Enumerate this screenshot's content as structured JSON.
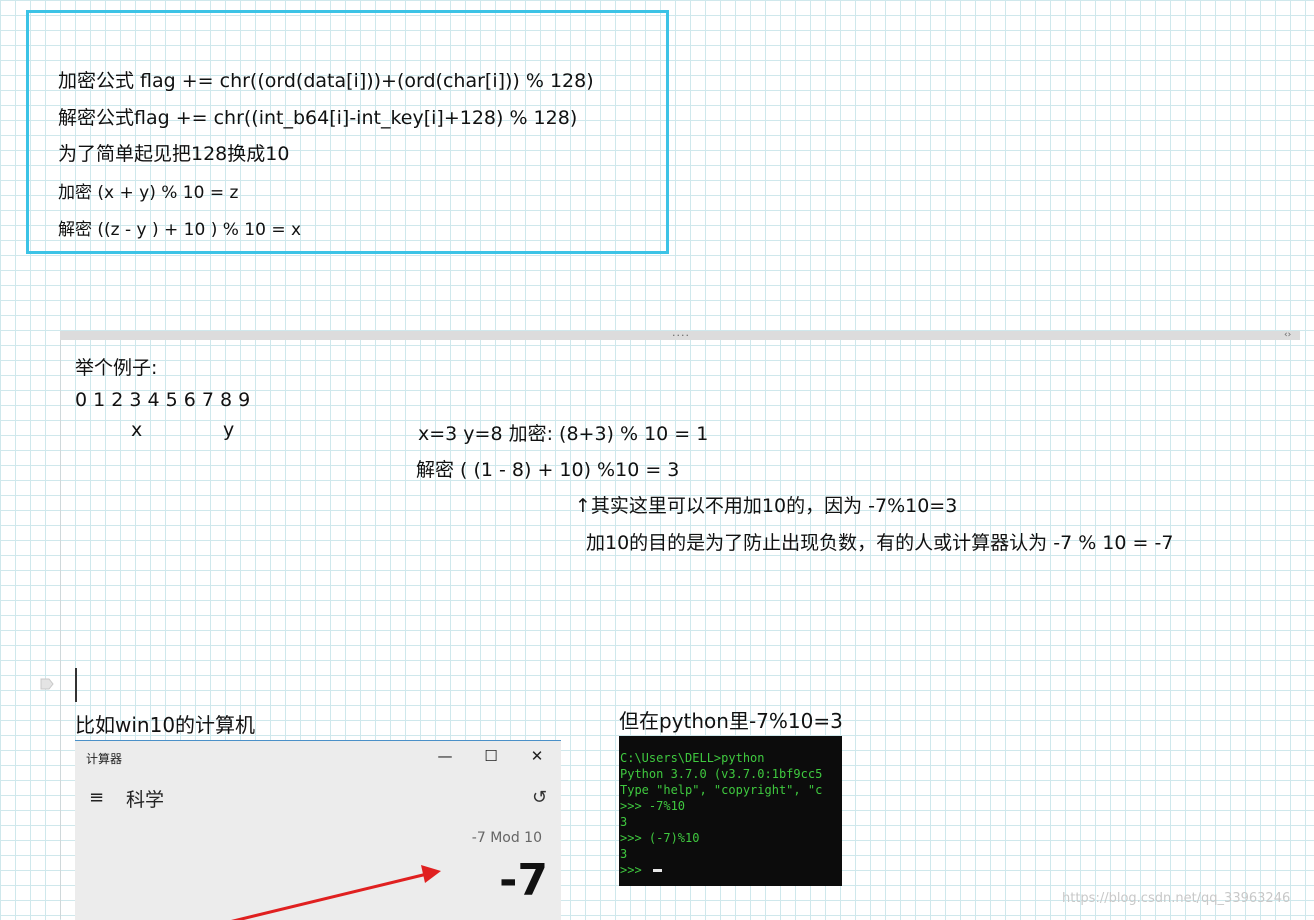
{
  "formula_box": {
    "lines": [
      "加密公式 flag += chr((ord(data[i]))+(ord(char[i])) % 128)",
      "解密公式flag += chr((int_b64[i]-int_key[i]+128) % 128)",
      "为了简单起见把128换成10",
      "加密 (x + y) % 10 = z",
      "解密 ((z - y ) + 10 ) % 10 =  x"
    ]
  },
  "divider": {
    "dots": "····",
    "arrows": "‹›"
  },
  "example": {
    "heading": "举个例子:",
    "digits": "0 1 2 3 4 5 6 7 8 9",
    "x_label": "x",
    "y_label": "y",
    "encrypt_line": "x=3 y=8 加密: (8+3) % 10 = 1",
    "decrypt_line": "解密 ( (1 - 8) + 10) %10 = 3",
    "note_line": "↑其实这里可以不用加10的，因为 -7%10=3",
    "reason_line": "加10的目的是为了防止出现负数，有的人或计算器认为  -7 % 10 =  -7"
  },
  "captions": {
    "win_calc": "比如win10的计算机",
    "python": "但在python里-7%10=3"
  },
  "calculator": {
    "title": "计算器",
    "minimize": "—",
    "maximize": "☐",
    "close": "✕",
    "menu_icon": "≡",
    "mode": "科学",
    "history_icon": "↺",
    "expression": "-7 Mod 10",
    "result": "-7"
  },
  "terminal": {
    "lines": [
      "C:\\Users\\DELL>python",
      "Python 3.7.0 (v3.7.0:1bf9cc5",
      "Type \"help\", \"copyright\", \"c",
      ">>> -7%10",
      "3",
      ">>> (-7)%10",
      "3",
      ">>> "
    ]
  },
  "watermark": "https://blog.csdn.net/qq_33963246",
  "colors": {
    "box_border": "#3cc3e6",
    "grid": "#cfe8ec",
    "terminal_text": "#3fc93f",
    "arrow": "#e02020"
  }
}
